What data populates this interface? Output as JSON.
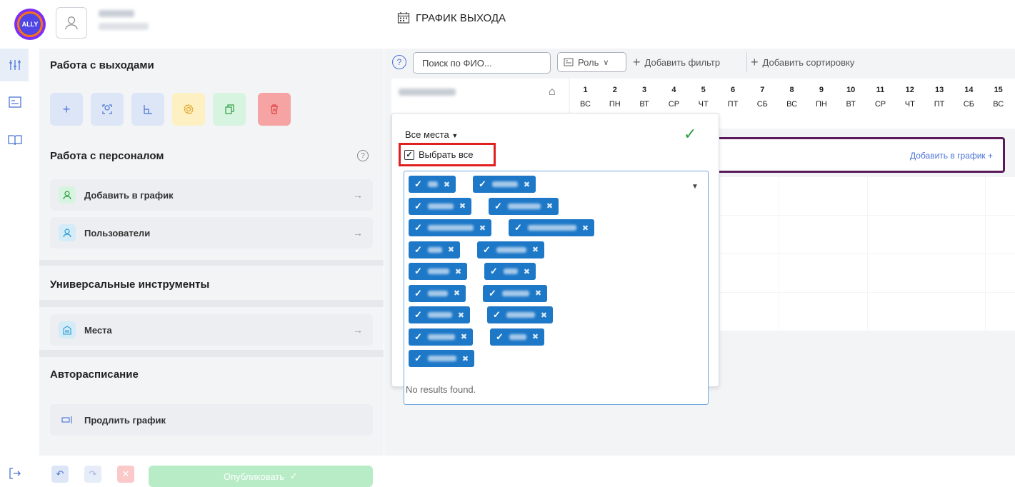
{
  "header": {
    "logo_text": "ALLY",
    "page_title": "ГРАФИК ВЫХОДА"
  },
  "panel": {
    "work_with_shifts": "Работа с выходами",
    "work_with_staff": "Работа с персоналом",
    "add_to_schedule": "Добавить в график",
    "users": "Пользователи",
    "universal_tools": "Универсальные инструменты",
    "places": "Места",
    "autoschedule": "Авторасписание",
    "extend_schedule": "Продлить график"
  },
  "toolbar": {
    "search_placeholder": "Поиск по ФИО...",
    "role_label": "Роль",
    "add_filter": "Добавить фильтр",
    "add_sort": "Добавить сортировку"
  },
  "calendar": {
    "days": [
      {
        "n": "1",
        "d": "ВС"
      },
      {
        "n": "2",
        "d": "ПН"
      },
      {
        "n": "3",
        "d": "ВТ"
      },
      {
        "n": "4",
        "d": "СР"
      },
      {
        "n": "5",
        "d": "ЧТ"
      },
      {
        "n": "6",
        "d": "ПТ"
      },
      {
        "n": "7",
        "d": "СБ"
      },
      {
        "n": "8",
        "d": "ВС"
      },
      {
        "n": "9",
        "d": "ПН"
      },
      {
        "n": "10",
        "d": "ВТ"
      },
      {
        "n": "11",
        "d": "СР"
      },
      {
        "n": "12",
        "d": "ЧТ"
      },
      {
        "n": "13",
        "d": "ПТ"
      },
      {
        "n": "14",
        "d": "СБ"
      },
      {
        "n": "15",
        "d": "ВС"
      }
    ],
    "add_to_schedule_link": "Добавить в график"
  },
  "dropdown": {
    "places_label": "Все места",
    "select_all": "Выбрать все",
    "no_results": "No results found."
  },
  "bottom": {
    "publish": "Опубликовать"
  },
  "colors": {
    "accent": "#4a73d8",
    "tag_blue": "#1e78c8",
    "highlight_red": "#e02020",
    "confirm_green": "#2e9e44"
  }
}
